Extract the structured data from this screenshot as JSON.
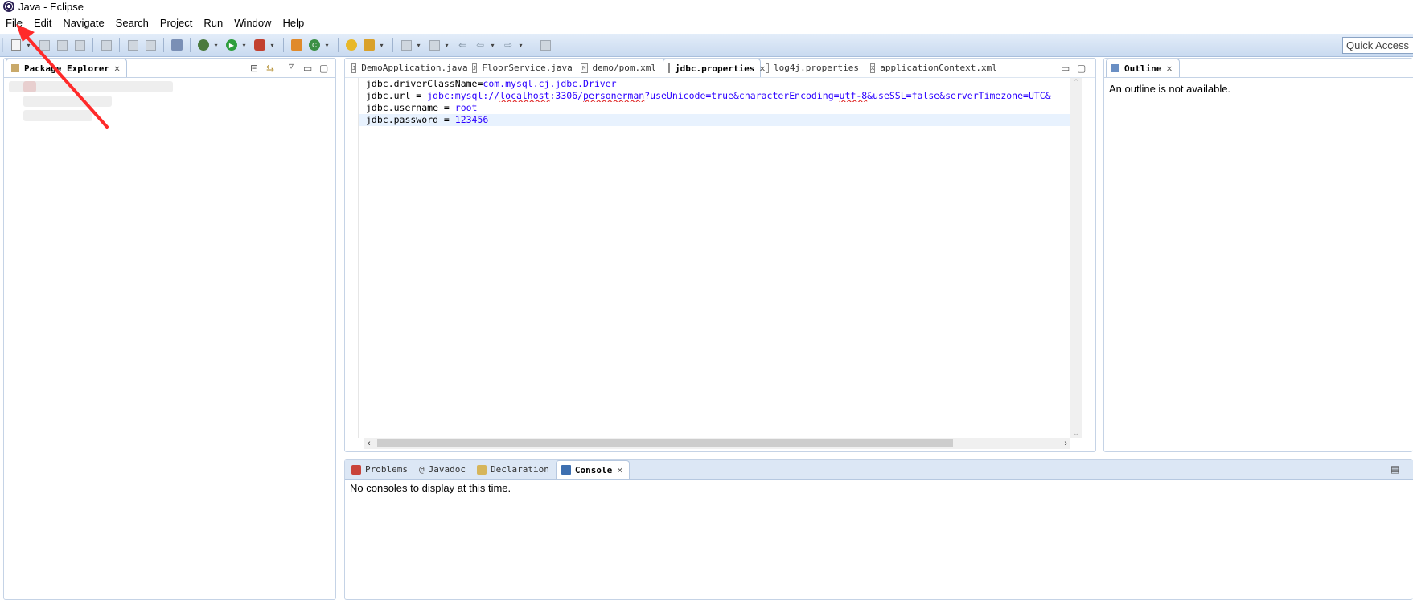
{
  "window": {
    "title": "Java - Eclipse"
  },
  "menu": [
    "File",
    "Edit",
    "Navigate",
    "Search",
    "Project",
    "Run",
    "Window",
    "Help"
  ],
  "quick_access": {
    "placeholder": "Quick Access"
  },
  "package_explorer": {
    "tab_label": "Package Explorer"
  },
  "editor": {
    "tabs": [
      {
        "label": "DemoApplication.java",
        "icon": "J"
      },
      {
        "label": "FloorService.java",
        "icon": "J"
      },
      {
        "label": "demo/pom.xml",
        "icon": "M"
      },
      {
        "label": "jdbc.properties",
        "icon": "",
        "active": true
      },
      {
        "label": "log4j.properties",
        "icon": ""
      },
      {
        "label": "applicationContext.xml",
        "icon": "X"
      }
    ],
    "lines": [
      {
        "key": "jdbc.driverClassName=",
        "value": "com.mysql.cj.jdbc.Driver"
      },
      {
        "key": "jdbc.url = ",
        "value": "jdbc:mysql://localhost:3306/personerman?useUnicode=true&characterEncoding=utf-8&useSSL=false&serverTimezone=UTC&"
      },
      {
        "key": "jdbc.username = ",
        "value": "root"
      },
      {
        "key": "jdbc.password = ",
        "value": "123456"
      }
    ]
  },
  "outline": {
    "tab_label": "Outline",
    "message": "An outline is not available."
  },
  "bottom": {
    "tabs": [
      "Problems",
      "Javadoc",
      "Declaration",
      "Console"
    ],
    "message": "No consoles to display at this time."
  },
  "colors": {
    "annotation_arrow": "#ff2a2a",
    "value_text": "#2a00ff",
    "toolbar_bg": "#d3e1f3"
  }
}
